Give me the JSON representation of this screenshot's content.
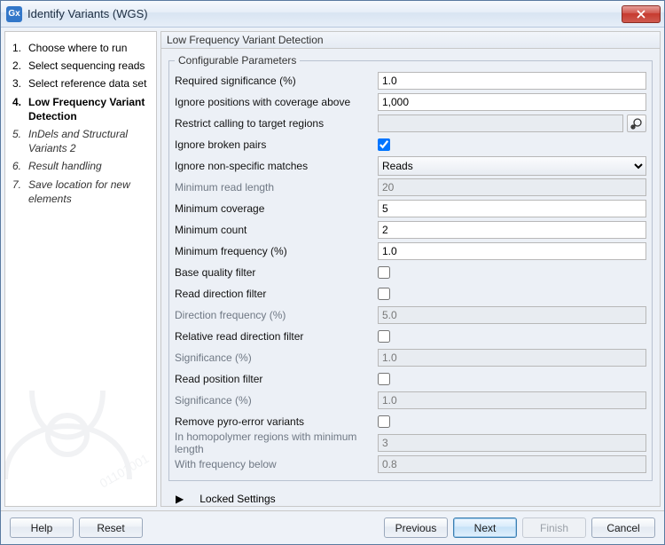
{
  "title": "Identify Variants (WGS)",
  "close_label": "Close",
  "sidebar": {
    "steps": [
      {
        "num": "1.",
        "label": "Choose where to run",
        "state": "done"
      },
      {
        "num": "2.",
        "label": "Select sequencing reads",
        "state": "done"
      },
      {
        "num": "3.",
        "label": "Select reference data set",
        "state": "done"
      },
      {
        "num": "4.",
        "label": "Low Frequency Variant Detection",
        "state": "current"
      },
      {
        "num": "5.",
        "label": "InDels and Structural Variants 2",
        "state": "future"
      },
      {
        "num": "6.",
        "label": "Result handling",
        "state": "future"
      },
      {
        "num": "7.",
        "label": "Save location for new elements",
        "state": "future"
      }
    ]
  },
  "main": {
    "header": "Low Frequency Variant Detection",
    "group_title": "Configurable Parameters",
    "params": [
      {
        "label": "Required significance (%)",
        "type": "text",
        "value": "1.0",
        "enabled": true
      },
      {
        "label": "Ignore positions with coverage above",
        "type": "text",
        "value": "1,000",
        "enabled": true
      },
      {
        "label": "Restrict calling to target regions",
        "type": "browse",
        "value": "",
        "enabled": true
      },
      {
        "label": "Ignore broken pairs",
        "type": "checkbox",
        "value": true,
        "enabled": true
      },
      {
        "label": "Ignore non-specific matches",
        "type": "select",
        "value": "Reads",
        "enabled": true
      },
      {
        "label": "Minimum read length",
        "type": "text",
        "value": "20",
        "enabled": false
      },
      {
        "label": "Minimum coverage",
        "type": "text",
        "value": "5",
        "enabled": true
      },
      {
        "label": "Minimum count",
        "type": "text",
        "value": "2",
        "enabled": true
      },
      {
        "label": "Minimum frequency (%)",
        "type": "text",
        "value": "1.0",
        "enabled": true
      },
      {
        "label": "Base quality filter",
        "type": "checkbox",
        "value": false,
        "enabled": true
      },
      {
        "label": "Read direction filter",
        "type": "checkbox",
        "value": false,
        "enabled": true
      },
      {
        "label": "Direction frequency (%)",
        "type": "text",
        "value": "5.0",
        "enabled": false
      },
      {
        "label": "Relative read direction filter",
        "type": "checkbox",
        "value": false,
        "enabled": true
      },
      {
        "label": "Significance (%)",
        "type": "text",
        "value": "1.0",
        "enabled": false
      },
      {
        "label": "Read position filter",
        "type": "checkbox",
        "value": false,
        "enabled": true
      },
      {
        "label": "Significance (%)",
        "type": "text",
        "value": "1.0",
        "enabled": false
      },
      {
        "label": "Remove pyro-error variants",
        "type": "checkbox",
        "value": false,
        "enabled": true
      },
      {
        "label": "In homopolymer regions with minimum length",
        "type": "text",
        "value": "3",
        "enabled": false
      },
      {
        "label": "With frequency below",
        "type": "text",
        "value": "0.8",
        "enabled": false
      }
    ],
    "locked_settings_label": "Locked Settings"
  },
  "footer": {
    "help": "Help",
    "reset": "Reset",
    "previous": "Previous",
    "next": "Next",
    "finish": "Finish",
    "cancel": "Cancel"
  },
  "icons": {
    "title": "Gx"
  }
}
